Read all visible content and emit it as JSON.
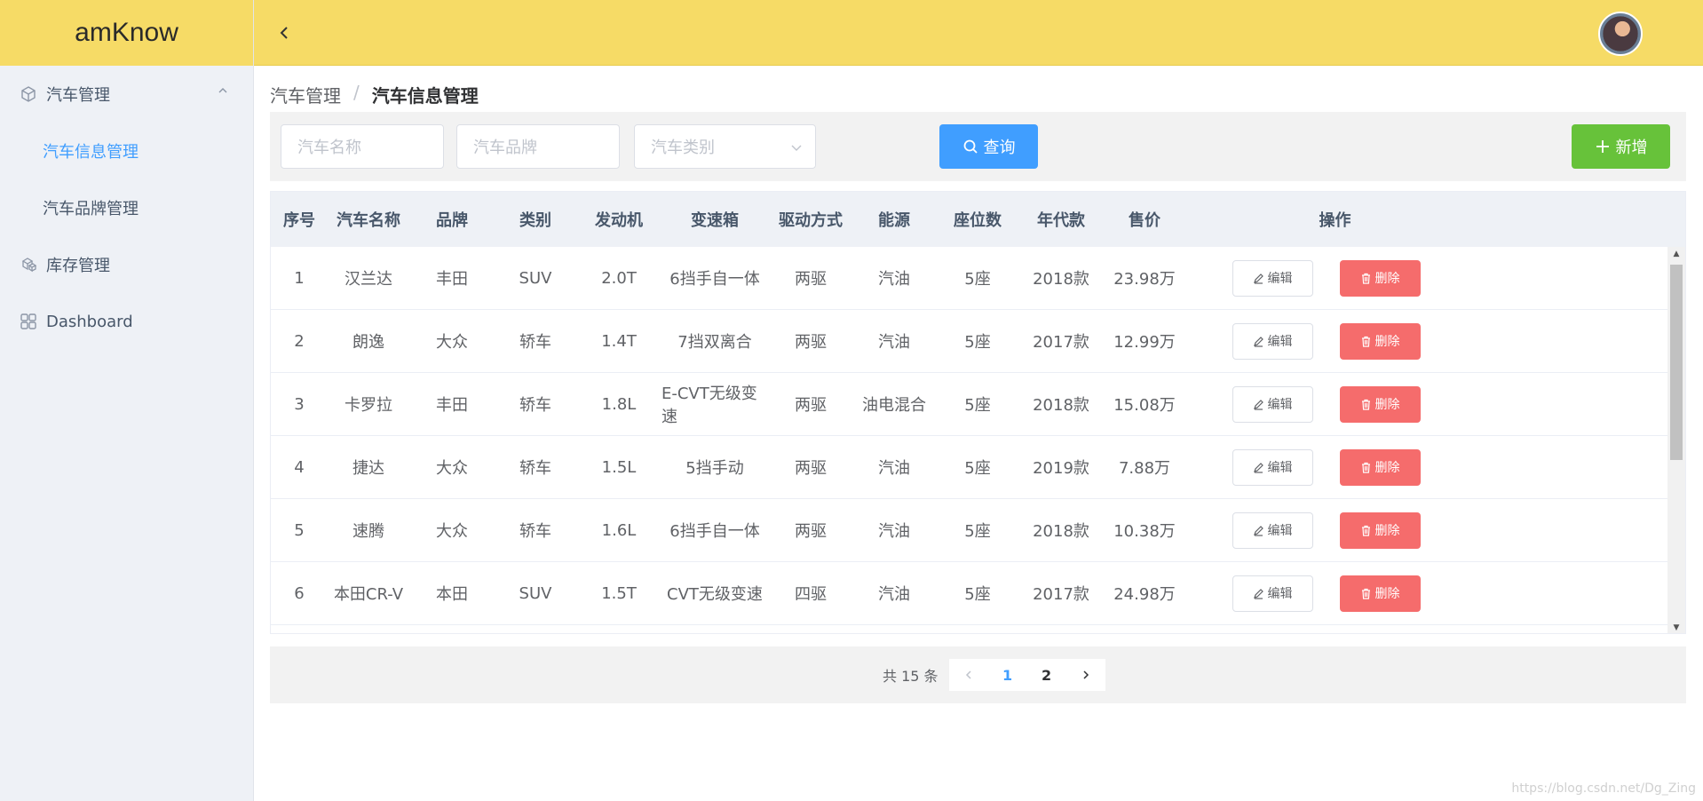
{
  "app": {
    "logo": "amKnow"
  },
  "sidebar": {
    "items": [
      {
        "label": "汽车管理",
        "icon": "cube-icon",
        "expanded": true
      },
      {
        "label": "汽车信息管理",
        "active": true
      },
      {
        "label": "汽车品牌管理"
      },
      {
        "label": "库存管理",
        "icon": "boxes-icon"
      },
      {
        "label": "Dashboard",
        "icon": "grid-icon"
      }
    ]
  },
  "header": {
    "collapse_icon": "chevron-left-icon",
    "avatar": "user-avatar"
  },
  "breadcrumb": {
    "parent": "汽车管理",
    "separator": "/",
    "current": "汽车信息管理"
  },
  "search": {
    "name_placeholder": "汽车名称",
    "brand_placeholder": "汽车品牌",
    "category_placeholder": "汽车类别",
    "query_label": "查询",
    "add_label": "新增"
  },
  "table": {
    "columns": [
      "序号",
      "汽车名称",
      "品牌",
      "类别",
      "发动机",
      "变速箱",
      "驱动方式",
      "能源",
      "座位数",
      "年代款",
      "售价",
      "操作"
    ],
    "rows": [
      [
        "1",
        "汉兰达",
        "丰田",
        "SUV",
        "2.0T",
        "6挡手自一体",
        "两驱",
        "汽油",
        "5座",
        "2018款",
        "23.98万"
      ],
      [
        "2",
        "朗逸",
        "大众",
        "轿车",
        "1.4T",
        "7挡双离合",
        "两驱",
        "汽油",
        "5座",
        "2017款",
        "12.99万"
      ],
      [
        "3",
        "卡罗拉",
        "丰田",
        "轿车",
        "1.8L",
        "E-CVT无级变速",
        "两驱",
        "油电混合",
        "5座",
        "2018款",
        "15.08万"
      ],
      [
        "4",
        "捷达",
        "大众",
        "轿车",
        "1.5L",
        "5挡手动",
        "两驱",
        "汽油",
        "5座",
        "2019款",
        "7.88万"
      ],
      [
        "5",
        "速腾",
        "大众",
        "轿车",
        "1.6L",
        "6挡手自一体",
        "两驱",
        "汽油",
        "5座",
        "2018款",
        "10.38万"
      ],
      [
        "6",
        "本田CR-V",
        "本田",
        "SUV",
        "1.5T",
        "CVT无级变速",
        "四驱",
        "汽油",
        "5座",
        "2017款",
        "24.98万"
      ]
    ],
    "edit_label": "编辑",
    "delete_label": "删除"
  },
  "pagination": {
    "total_text": "共 15 条",
    "pages": [
      "1",
      "2"
    ],
    "current": "1"
  },
  "colors": {
    "header": "#f6db66",
    "primary": "#409eff",
    "success": "#67c23a",
    "danger": "#f56c6c"
  },
  "watermark": "https://blog.csdn.net/Dg_Zing"
}
